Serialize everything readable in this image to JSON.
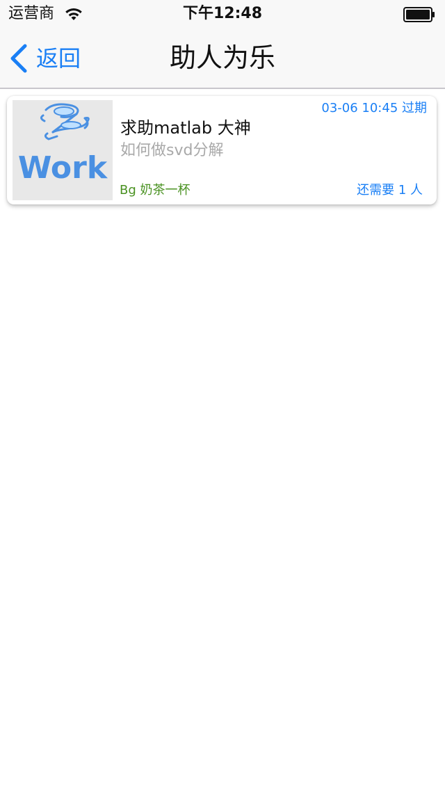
{
  "status_bar": {
    "carrier": "运营商",
    "time": "下午12:48",
    "wifi_icon": "wifi-icon",
    "battery_icon": "battery-icon"
  },
  "nav": {
    "back_label": "返回",
    "back_icon": "chevron-left-icon",
    "title": "助人为乐"
  },
  "colors": {
    "accent": "#1a7ff5",
    "reward_green": "#4a9222",
    "subtitle_gray": "#a9a9a9"
  },
  "cards": [
    {
      "thumbnail_text": "Work",
      "thumbnail_icon": "zwork-logo",
      "time_status": "03-06 10:45 过期",
      "title": "求助matlab 大神",
      "subtitle": "如何做svd分解",
      "reward": "Bg 奶茶一杯",
      "needed": "还需要 1 人"
    }
  ]
}
